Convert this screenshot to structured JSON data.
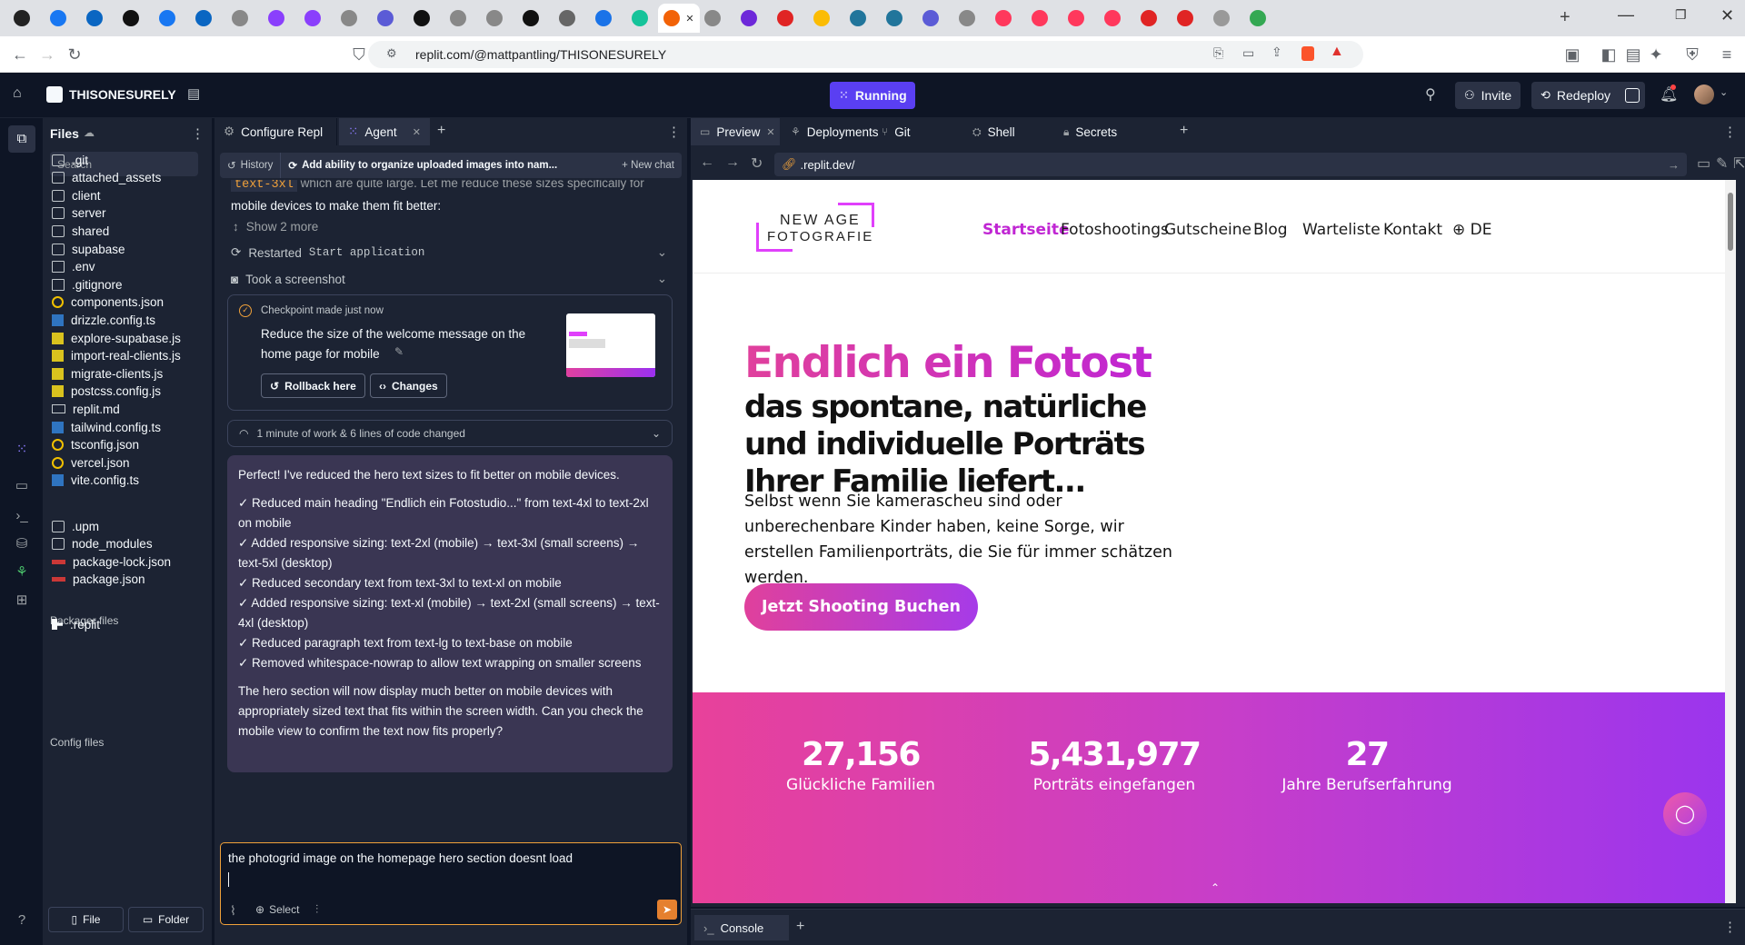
{
  "browser": {
    "url": "replit.com/@mattpantling/THISONESURELY",
    "tabs": [
      {
        "icon": "circle-dot-icon",
        "color": "#222"
      },
      {
        "icon": "facebook-icon",
        "color": "#1877f2"
      },
      {
        "icon": "meta-icon",
        "color": "#0a66c2"
      },
      {
        "icon": "threads-icon",
        "color": "#111"
      },
      {
        "icon": "facebook-icon",
        "color": "#1877f2"
      },
      {
        "icon": "meta-icon",
        "color": "#0a66c2"
      },
      {
        "icon": "generic-icon",
        "color": "#888"
      },
      {
        "icon": "swirl-icon",
        "color": "#8a3ffc"
      },
      {
        "icon": "swirl-icon",
        "color": "#8a3ffc"
      },
      {
        "icon": "generic-icon",
        "color": "#888"
      },
      {
        "icon": "s-icon",
        "color": "#5b5bd6"
      },
      {
        "icon": "triangle-icon",
        "color": "#111"
      },
      {
        "icon": "generic-icon",
        "color": "#888"
      },
      {
        "icon": "generic-icon",
        "color": "#888"
      },
      {
        "icon": "github-icon",
        "color": "#111"
      },
      {
        "icon": "record-icon",
        "color": "#666"
      },
      {
        "icon": "globe-icon",
        "color": "#1a73e8"
      },
      {
        "icon": "grammarly-icon",
        "color": "#15c39a"
      },
      {
        "icon": "replit-icon",
        "color": "#f26207"
      },
      {
        "icon": "generic-icon",
        "color": "#888"
      },
      {
        "icon": "mail-icon",
        "color": "#6d28d9"
      },
      {
        "icon": "asterisk-icon",
        "color": "#e02424"
      },
      {
        "icon": "drive-icon",
        "color": "#fbbc04"
      },
      {
        "icon": "wordpress-icon",
        "color": "#21759b"
      },
      {
        "icon": "wordpress-icon",
        "color": "#21759b"
      },
      {
        "icon": "s-icon",
        "color": "#5b5bd6"
      },
      {
        "icon": "generic-icon",
        "color": "#888"
      },
      {
        "icon": "airbnb-icon",
        "color": "#ff385c"
      },
      {
        "icon": "airbnb-icon",
        "color": "#ff385c"
      },
      {
        "icon": "airbnb-icon",
        "color": "#ff385c"
      },
      {
        "icon": "airbnb-icon",
        "color": "#ff385c"
      },
      {
        "icon": "asterisk-icon",
        "color": "#e02424"
      },
      {
        "icon": "asterisk-icon",
        "color": "#e02424"
      },
      {
        "icon": "lines-icon",
        "color": "#999"
      },
      {
        "icon": "maps-icon",
        "color": "#34a853"
      }
    ]
  },
  "topbar": {
    "repl_name": "THISONESURELY",
    "run_label": "Running",
    "invite_label": "Invite",
    "redeploy_label": "Redeploy"
  },
  "files": {
    "title": "Files",
    "search_placeholder": "Search",
    "items": [
      {
        "name": ".git",
        "type": "folder"
      },
      {
        "name": "attached_assets",
        "type": "folder"
      },
      {
        "name": "client",
        "type": "folder"
      },
      {
        "name": "server",
        "type": "folder"
      },
      {
        "name": "shared",
        "type": "folder"
      },
      {
        "name": "supabase",
        "type": "folder"
      },
      {
        "name": ".env",
        "type": "file"
      },
      {
        "name": ".gitignore",
        "type": "file"
      },
      {
        "name": "components.json",
        "type": "json"
      },
      {
        "name": "drizzle.config.ts",
        "type": "ts"
      },
      {
        "name": "explore-supabase.js",
        "type": "js"
      },
      {
        "name": "import-real-clients.js",
        "type": "js"
      },
      {
        "name": "migrate-clients.js",
        "type": "js"
      },
      {
        "name": "postcss.config.js",
        "type": "js"
      },
      {
        "name": "replit.md",
        "type": "md"
      },
      {
        "name": "tailwind.config.ts",
        "type": "ts"
      },
      {
        "name": "tsconfig.json",
        "type": "json"
      },
      {
        "name": "vercel.json",
        "type": "json"
      },
      {
        "name": "vite.config.ts",
        "type": "ts"
      }
    ],
    "packager_title": "Packager files",
    "packager_items": [
      {
        "name": ".upm",
        "type": "folder"
      },
      {
        "name": "node_modules",
        "type": "folder"
      },
      {
        "name": "package-lock.json",
        "type": "npm"
      },
      {
        "name": "package.json",
        "type": "npm"
      }
    ],
    "config_title": "Config files",
    "config_items": [
      {
        "name": ".replit",
        "type": "replit"
      }
    ],
    "new_file_label": "File",
    "new_folder_label": "Folder"
  },
  "agent": {
    "tab_configure": "Configure Repl",
    "tab_agent": "Agent",
    "history_label": "History",
    "chat_title": "Add ability to organize uploaded images into nam...",
    "new_chat_label": "New chat",
    "prev_text_code": "text-3xl",
    "prev_text_a": "which are quite large. Let me reduce these sizes specifically for",
    "prev_text_b": "mobile devices to make them fit better:",
    "show_more": "Show 2 more",
    "restarted_prefix": "Restarted",
    "restarted_code": "Start application",
    "screenshot_label": "Took a screenshot",
    "checkpoint_label": "Checkpoint made just now",
    "checkpoint_msg": "Reduce the size of the welcome message on the home page for mobile",
    "rollback_label": "Rollback here",
    "changes_label": "Changes",
    "work_summary": "1 minute of work & 6 lines of code changed",
    "reply_intro": "Perfect! I've reduced the hero text sizes to fit better on mobile devices.",
    "reply_items": [
      "✓ Reduced main heading \"Endlich ein Fotostudio...\" from text-4xl to text-2xl on mobile",
      "✓ Added responsive sizing: text-2xl (mobile) → text-3xl (small screens) → text-5xl (desktop)",
      "✓ Reduced secondary text from text-3xl to text-xl on mobile",
      "✓ Added responsive sizing: text-xl (mobile) → text-2xl (small screens) → text-4xl (desktop)",
      "✓ Reduced paragraph text from text-lg to text-base on mobile",
      "✓ Removed whitespace-nowrap to allow text wrapping on smaller screens"
    ],
    "reply_outro": "The hero section will now display much better on mobile devices with appropriately sized text that fits within the screen width. Can you check the mobile view to confirm the text now fits properly?",
    "input_value": "the photogrid image on the homepage hero section doesnt load",
    "select_label": "Select"
  },
  "preview": {
    "tabs": [
      "Preview",
      "Deployments",
      "Git",
      "Shell",
      "Secrets"
    ],
    "url": ".replit.dev/",
    "console_label": "Console"
  },
  "site": {
    "logo_line1": "NEW AGE",
    "logo_line2": "FOTOGRAFIE",
    "nav": [
      "Startseite",
      "Fotoshootings",
      "Gutscheine",
      "Blog",
      "Warteliste",
      "Kontakt",
      "DE"
    ],
    "hero_title": "Endlich ein Fotost",
    "hero_sub": "das spontane, natürliche und individuelle Porträts Ihrer Familie liefert...",
    "hero_para": "Selbst wenn Sie kamerascheu sind oder unberechenbare Kinder haben, keine Sorge, wir erstellen Familienporträts, die Sie für immer schätzen werden.",
    "cta": "Jetzt Shooting Buchen",
    "stats": [
      {
        "value": "27,156",
        "label": "Glückliche Familien"
      },
      {
        "value": "5,431,977",
        "label": "Porträts eingefangen"
      },
      {
        "value": "27",
        "label": "Jahre Berufserfahrung"
      }
    ],
    "brand_color": "#e040fb",
    "accent_color": "#c026d3"
  }
}
